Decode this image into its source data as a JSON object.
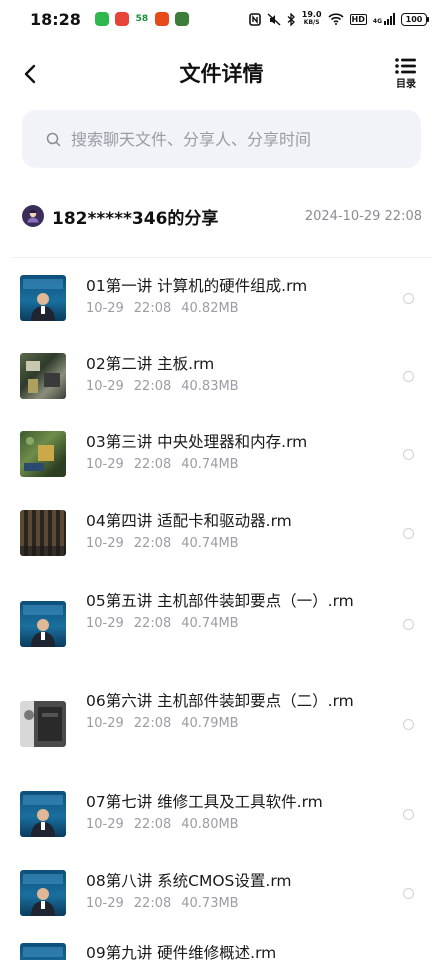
{
  "status_bar": {
    "time": "18:28",
    "net_speed_value": "19.0",
    "net_speed_unit": "KB/S",
    "hd_label": "HD",
    "signal_label": "4G",
    "battery": "100"
  },
  "header": {
    "title": "文件详情",
    "toc_label": "目录"
  },
  "search": {
    "placeholder": "搜索聊天文件、分享人、分享时间"
  },
  "share": {
    "name": "182*****346的分享",
    "time": "2024-10-29  22:08"
  },
  "files": [
    {
      "name": "01第一讲 计算机的硬件组成.rm",
      "date": "10-29",
      "time": "22:08",
      "size": "40.82MB",
      "thumb": "lecture"
    },
    {
      "name": "02第二讲 主板.rm",
      "date": "10-29",
      "time": "22:08",
      "size": "40.83MB",
      "thumb": "board"
    },
    {
      "name": "03第三讲 中央处理器和内存.rm",
      "date": "10-29",
      "time": "22:08",
      "size": "40.74MB",
      "thumb": "cpu"
    },
    {
      "name": "04第四讲 适配卡和驱动器.rm",
      "date": "10-29",
      "time": "22:08",
      "size": "40.74MB",
      "thumb": "card"
    },
    {
      "name": "05第五讲 主机部件装卸要点（一）.rm",
      "date": "10-29",
      "time": "22:08",
      "size": "40.74MB",
      "thumb": "lecture"
    },
    {
      "name": "06第六讲 主机部件装卸要点（二）.rm",
      "date": "10-29",
      "time": "22:08",
      "size": "40.79MB",
      "thumb": "case"
    },
    {
      "name": "07第七讲 维修工具及工具软件.rm",
      "date": "10-29",
      "time": "22:08",
      "size": "40.80MB",
      "thumb": "lecture"
    },
    {
      "name": "08第八讲 系统CMOS设置.rm",
      "date": "10-29",
      "time": "22:08",
      "size": "40.73MB",
      "thumb": "lecture"
    },
    {
      "name": "09第九讲 硬件维修概述.rm",
      "date": "",
      "time": "",
      "size": "",
      "thumb": "lecture"
    }
  ]
}
